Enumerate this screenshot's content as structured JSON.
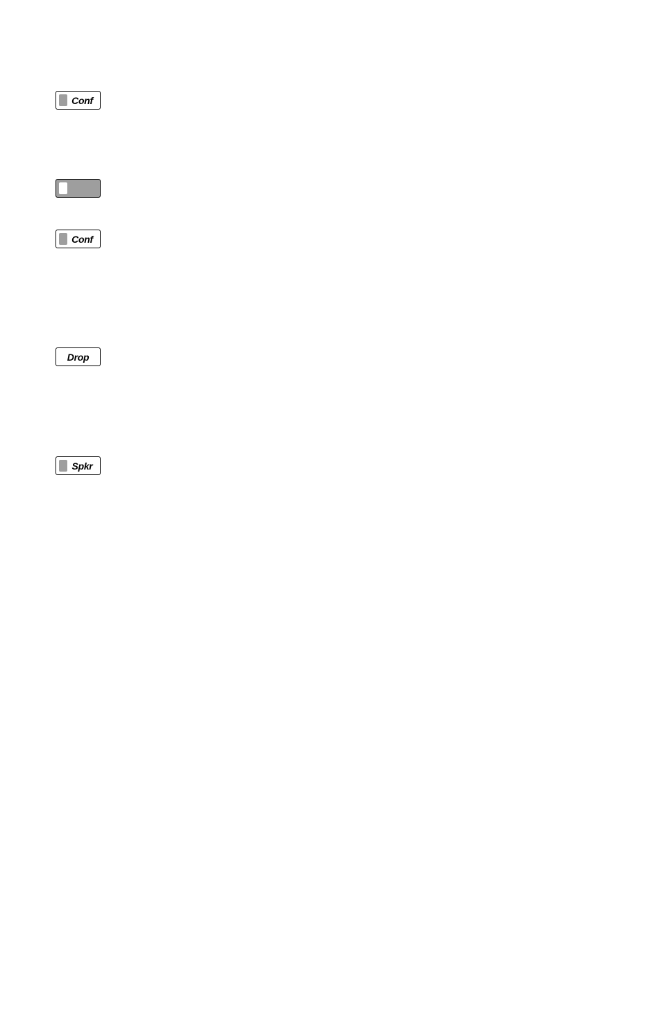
{
  "buttons": {
    "b1": {
      "label": "Conf"
    },
    "b2": {
      "label": ""
    },
    "b3": {
      "label": "Conf"
    },
    "b4": {
      "label": "Drop"
    },
    "b5": {
      "label": "Spkr"
    }
  }
}
